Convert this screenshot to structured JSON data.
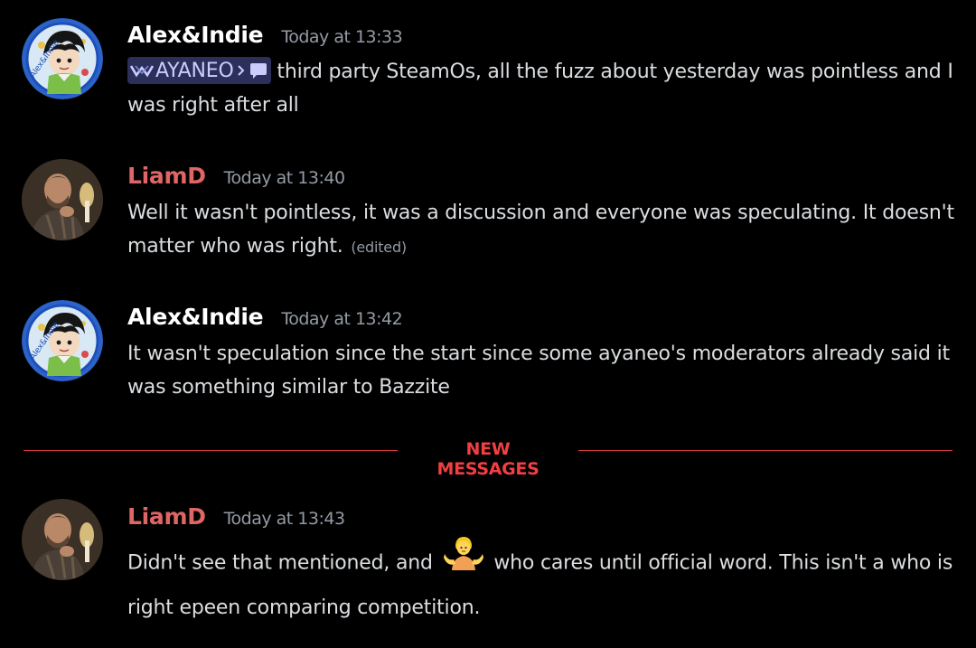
{
  "colors": {
    "background": "#000000",
    "user_alex": "#ffffff",
    "user_liam": "#e06666",
    "timestamp": "#949ba4",
    "text": "#dbdee1",
    "new_messages": "#f23f42"
  },
  "messages": [
    {
      "username": "Alex&Indie",
      "timestamp": "Today at 13:33",
      "avatar": "avatar-anime-character",
      "channel_mention": {
        "icon": "ayaneo-logo-icon",
        "server": "AYANEO",
        "separator_icon": "chevron-right-icon",
        "channel_icon": "chat-bubble-icon"
      },
      "text": " third party SteamOs, all the fuzz about yesterday was pointless and I was right after all"
    },
    {
      "username": "LiamD",
      "timestamp": "Today at 13:40",
      "avatar": "avatar-photo-man",
      "text": "Well it wasn't pointless, it was a discussion and everyone was speculating. It doesn't matter who was right.",
      "edited": "(edited)"
    },
    {
      "username": "Alex&Indie",
      "timestamp": "Today at 13:42",
      "avatar": "avatar-anime-character",
      "text": "It wasn't speculation since the start since some ayaneo's moderators already said it was something similar to Bazzite"
    },
    {
      "username": "LiamD",
      "timestamp": "Today at 13:43",
      "avatar": "avatar-photo-man",
      "text_before_emoji": "Didn't see that mentioned, and",
      "emoji": "person-shrugging-emoji",
      "text_after_emoji": "who cares until official word. This isn't a who is right epeen comparing competition."
    }
  ],
  "divider": {
    "label": "NEW MESSAGES"
  }
}
